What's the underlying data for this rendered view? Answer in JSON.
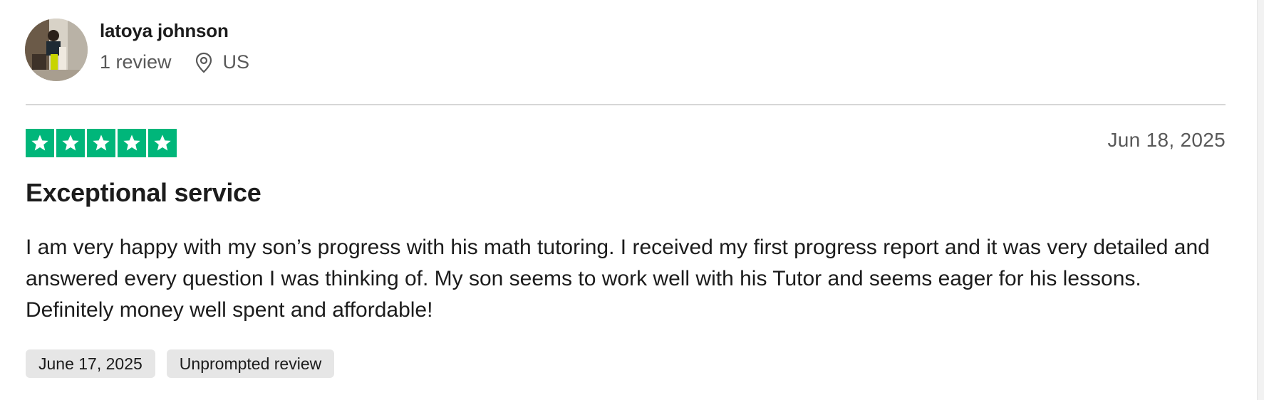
{
  "reviewer": {
    "name": "latoya johnson",
    "review_count": "1 review",
    "country": "US",
    "avatar_icon": "user-photo-avatar",
    "location_icon": "location-pin-icon"
  },
  "review": {
    "rating": 5,
    "rating_max": 5,
    "star_color": "#00b67a",
    "date": "Jun 18, 2025",
    "title": "Exceptional service",
    "body": "I am very happy with my son’s progress with his math tutoring. I received my first progress report and it was very detailed and answered every question I was thinking of. My son seems to work well with his Tutor and seems eager for his lessons. Definitely money well spent and affordable!",
    "tags": [
      {
        "label": "June 17, 2025"
      },
      {
        "label": "Unprompted review"
      }
    ]
  }
}
